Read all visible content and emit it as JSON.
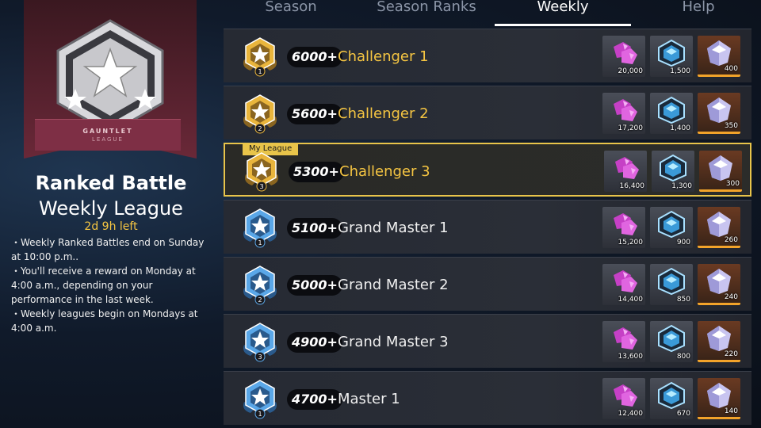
{
  "tabs": [
    {
      "label": "Season"
    },
    {
      "label": "Season Ranks"
    },
    {
      "label": "Weekly",
      "active": true
    },
    {
      "label": "Help"
    }
  ],
  "banner": {
    "line1": "GAUNTLET",
    "line2": "LEAGUE"
  },
  "title_line1": "Ranked Battle",
  "title_line2": "Weekly League",
  "time_left": "2d 9h left",
  "notes": [
    "・Weekly Ranked Battles end on Sunday at 10:00 p.m..",
    "・You'll receive a reward on Monday at 4:00 a.m., depending on your performance in the last week.",
    "・Weekly leagues begin on Mondays at 4:00 a.m."
  ],
  "my_league_label": "My League",
  "colors": {
    "gold": "#f5c542",
    "accent_orange": "#f2a32a",
    "highlight_border": "#e8c44a"
  },
  "rows": [
    {
      "score": "6000+",
      "name": "Challenger 1",
      "tier": "gold",
      "level": "1",
      "rewards": [
        "20,000",
        "1,500",
        "400"
      ],
      "my": false
    },
    {
      "score": "5600+",
      "name": "Challenger 2",
      "tier": "gold",
      "level": "2",
      "rewards": [
        "17,200",
        "1,400",
        "350"
      ],
      "my": false
    },
    {
      "score": "5300+",
      "name": "Challenger 3",
      "tier": "gold",
      "level": "3",
      "rewards": [
        "16,400",
        "1,300",
        "300"
      ],
      "my": true
    },
    {
      "score": "5100+",
      "name": "Grand Master 1",
      "tier": "blue",
      "level": "1",
      "rewards": [
        "15,200",
        "900",
        "260"
      ],
      "my": false
    },
    {
      "score": "5000+",
      "name": "Grand Master 2",
      "tier": "blue",
      "level": "2",
      "rewards": [
        "14,400",
        "850",
        "240"
      ],
      "my": false
    },
    {
      "score": "4900+",
      "name": "Grand Master 3",
      "tier": "blue",
      "level": "3",
      "rewards": [
        "13,600",
        "800",
        "220"
      ],
      "my": false
    },
    {
      "score": "4700+",
      "name": "Master 1",
      "tier": "blue",
      "level": "1",
      "rewards": [
        "12,400",
        "670",
        "140"
      ],
      "my": false
    }
  ],
  "reward_icons": [
    "purple-crystal-icon",
    "blue-hexagon-icon",
    "white-gem-icon"
  ]
}
